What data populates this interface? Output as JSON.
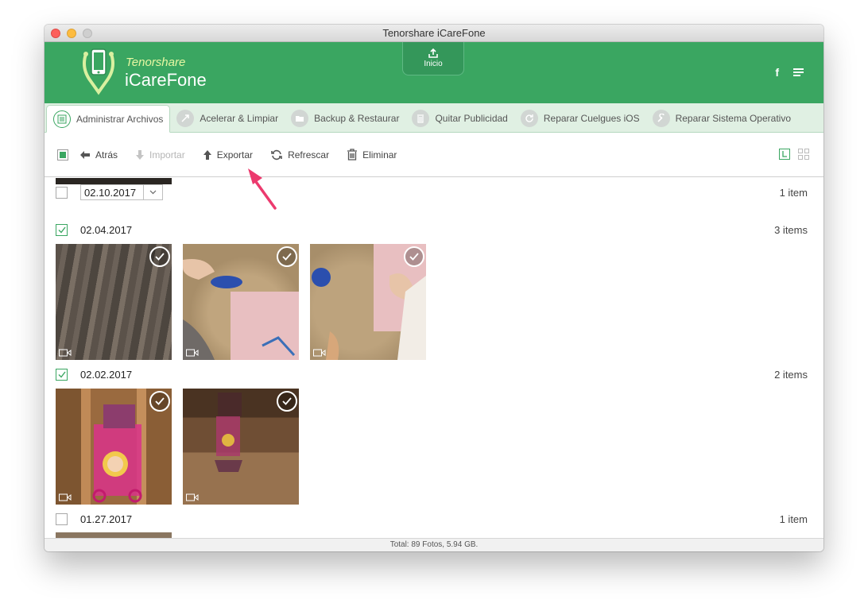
{
  "window": {
    "title": "Tenorshare iCareFone"
  },
  "header": {
    "brand_small": "Tenorshare",
    "brand_big": "iCareFone",
    "home_label": "Inicio",
    "facebook_label": "f"
  },
  "tabs": [
    {
      "label": "Administrar Archivos",
      "icon": "file-manager-icon"
    },
    {
      "label": "Acelerar & Limpiar",
      "icon": "rocket-icon"
    },
    {
      "label": "Backup & Restaurar",
      "icon": "folder-icon"
    },
    {
      "label": "Quitar Publicidad",
      "icon": "trash-icon"
    },
    {
      "label": "Reparar Cuelgues iOS",
      "icon": "refresh-icon"
    },
    {
      "label": "Reparar Sistema Operativo",
      "icon": "wrench-icon"
    }
  ],
  "toolbar": {
    "back": "Atrás",
    "import": "Importar",
    "export": "Exportar",
    "refresh": "Refrescar",
    "delete": "Eliminar"
  },
  "groups": [
    {
      "date": "02.10.2017",
      "count": "1 item",
      "checked": false
    },
    {
      "date": "02.04.2017",
      "count": "3 items",
      "checked": true
    },
    {
      "date": "02.02.2017",
      "count": "2 items",
      "checked": true
    },
    {
      "date": "01.27.2017",
      "count": "1 item",
      "checked": false
    }
  ],
  "status": {
    "total": "Total: 89 Fotos, 5.94 GB."
  },
  "colors": {
    "brand_green": "#3aa661",
    "accent_yellow": "#e7f7a2",
    "arrow_pink": "#ec3a6e"
  }
}
